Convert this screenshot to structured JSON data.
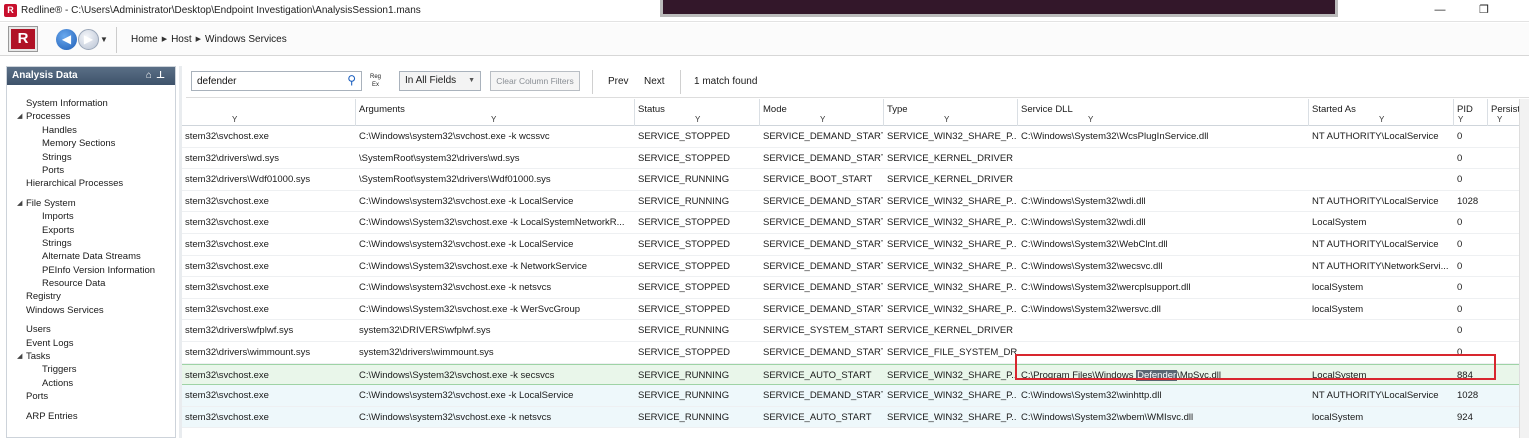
{
  "window": {
    "title": "Redline® - C:\\Users\\Administrator\\Desktop\\Endpoint Investigation\\AnalysisSession1.mans",
    "logo_letter": "R",
    "minimize": "—",
    "restore": "❐"
  },
  "nav": {
    "breadcrumb": [
      "Home",
      "Host",
      "Windows Services"
    ],
    "back_glyph": "◀",
    "forward_glyph": "▶",
    "dropdown_glyph": "▼"
  },
  "sidebar": {
    "title": "Analysis Data",
    "items": [
      {
        "label": "System Information",
        "level": 0
      },
      {
        "label": "Processes",
        "level": 0,
        "expanded": true
      },
      {
        "label": "Handles",
        "level": 1
      },
      {
        "label": "Memory Sections",
        "level": 1
      },
      {
        "label": "Strings",
        "level": 1
      },
      {
        "label": "Ports",
        "level": 1
      },
      {
        "label": "Hierarchical Processes",
        "level": 0
      },
      {
        "label": "File System",
        "level": 0,
        "expanded": true,
        "gap_before": true
      },
      {
        "label": "Imports",
        "level": 1
      },
      {
        "label": "Exports",
        "level": 1
      },
      {
        "label": "Strings",
        "level": 1
      },
      {
        "label": "Alternate Data Streams",
        "level": 1
      },
      {
        "label": "PEInfo Version Information",
        "level": 1
      },
      {
        "label": "Resource Data",
        "level": 1
      },
      {
        "label": "Registry",
        "level": 0
      },
      {
        "label": "Windows Services",
        "level": 0
      },
      {
        "label": "Users",
        "level": 0,
        "gap_before": true
      },
      {
        "label": "Event Logs",
        "level": 0
      },
      {
        "label": "Tasks",
        "level": 0,
        "expanded": true
      },
      {
        "label": "Triggers",
        "level": 1
      },
      {
        "label": "Actions",
        "level": 1
      },
      {
        "label": "Ports",
        "level": 0
      },
      {
        "label": "ARP Entries",
        "level": 0,
        "gap_before": true
      }
    ]
  },
  "toolbar": {
    "search_value": "defender",
    "regex_label": [
      "Reg",
      "Ex"
    ],
    "field_scope": "In All Fields",
    "clear_filters": "Clear Column Filters",
    "prev": "Prev",
    "next": "Next",
    "match_status": "1 match found"
  },
  "table": {
    "columns": [
      "",
      "Arguments",
      "Status",
      "Mode",
      "Type",
      "Service DLL",
      "Started As",
      "PID",
      "Persist"
    ],
    "rows": [
      [
        "stem32\\svchost.exe",
        "C:\\Windows\\system32\\svchost.exe -k wcssvc",
        "SERVICE_STOPPED",
        "SERVICE_DEMAND_START",
        "SERVICE_WIN32_SHARE_P...",
        "C:\\Windows\\System32\\WcsPlugInService.dll",
        "NT AUTHORITY\\LocalService",
        "0"
      ],
      [
        "stem32\\drivers\\wd.sys",
        "\\SystemRoot\\system32\\drivers\\wd.sys",
        "SERVICE_STOPPED",
        "SERVICE_DEMAND_START",
        "SERVICE_KERNEL_DRIVER",
        "",
        "",
        "0"
      ],
      [
        "stem32\\drivers\\Wdf01000.sys",
        "\\SystemRoot\\system32\\drivers\\Wdf01000.sys",
        "SERVICE_RUNNING",
        "SERVICE_BOOT_START",
        "SERVICE_KERNEL_DRIVER",
        "",
        "",
        "0"
      ],
      [
        "stem32\\svchost.exe",
        "C:\\Windows\\system32\\svchost.exe -k LocalService",
        "SERVICE_RUNNING",
        "SERVICE_DEMAND_START",
        "SERVICE_WIN32_SHARE_P...",
        "C:\\Windows\\System32\\wdi.dll",
        "NT AUTHORITY\\LocalService",
        "1028"
      ],
      [
        "stem32\\svchost.exe",
        "C:\\Windows\\System32\\svchost.exe -k LocalSystemNetworkR...",
        "SERVICE_STOPPED",
        "SERVICE_DEMAND_START",
        "SERVICE_WIN32_SHARE_P...",
        "C:\\Windows\\System32\\wdi.dll",
        "LocalSystem",
        "0"
      ],
      [
        "stem32\\svchost.exe",
        "C:\\Windows\\system32\\svchost.exe -k LocalService",
        "SERVICE_STOPPED",
        "SERVICE_DEMAND_START",
        "SERVICE_WIN32_SHARE_P...",
        "C:\\Windows\\System32\\WebClnt.dll",
        "NT AUTHORITY\\LocalService",
        "0"
      ],
      [
        "stem32\\svchost.exe",
        "C:\\Windows\\System32\\svchost.exe -k NetworkService",
        "SERVICE_STOPPED",
        "SERVICE_DEMAND_START",
        "SERVICE_WIN32_SHARE_P...",
        "C:\\Windows\\System32\\wecsvc.dll",
        "NT AUTHORITY\\NetworkServi...",
        "0"
      ],
      [
        "stem32\\svchost.exe",
        "C:\\Windows\\system32\\svchost.exe -k netsvcs",
        "SERVICE_STOPPED",
        "SERVICE_DEMAND_START",
        "SERVICE_WIN32_SHARE_P...",
        "C:\\Windows\\System32\\wercplsupport.dll",
        "localSystem",
        "0"
      ],
      [
        "stem32\\svchost.exe",
        "C:\\Windows\\System32\\svchost.exe -k WerSvcGroup",
        "SERVICE_STOPPED",
        "SERVICE_DEMAND_START",
        "SERVICE_WIN32_SHARE_P...",
        "C:\\Windows\\System32\\wersvc.dll",
        "localSystem",
        "0"
      ],
      [
        "stem32\\drivers\\wfplwf.sys",
        "system32\\DRIVERS\\wfplwf.sys",
        "SERVICE_RUNNING",
        "SERVICE_SYSTEM_START",
        "SERVICE_KERNEL_DRIVER",
        "",
        "",
        "0"
      ],
      [
        "stem32\\drivers\\wimmount.sys",
        "system32\\drivers\\wimmount.sys",
        "SERVICE_STOPPED",
        "SERVICE_DEMAND_START",
        "SERVICE_FILE_SYSTEM_DRI...",
        "",
        "",
        "0"
      ],
      [
        "stem32\\svchost.exe",
        "C:\\Windows\\System32\\svchost.exe -k secsvcs",
        "SERVICE_RUNNING",
        "SERVICE_AUTO_START",
        "SERVICE_WIN32_SHARE_P...",
        "C:\\Program Files\\Windows Defender\\MpSvc.dll",
        "LocalSystem",
        "884"
      ],
      [
        "stem32\\svchost.exe",
        "C:\\Windows\\system32\\svchost.exe -k LocalService",
        "SERVICE_RUNNING",
        "SERVICE_DEMAND_START",
        "SERVICE_WIN32_SHARE_P...",
        "C:\\Windows\\System32\\winhttp.dll",
        "NT AUTHORITY\\LocalService",
        "1028"
      ],
      [
        "stem32\\svchost.exe",
        "C:\\Windows\\system32\\svchost.exe -k netsvcs",
        "SERVICE_RUNNING",
        "SERVICE_AUTO_START",
        "SERVICE_WIN32_SHARE_P...",
        "C:\\Windows\\System32\\wbem\\WMIsvc.dll",
        "localSystem",
        "924"
      ]
    ],
    "match_row": 11,
    "match_text": "Defender",
    "selected_rows": [
      11
    ],
    "alt_rows": [
      12,
      13
    ],
    "highlight_colors": {
      "match_border": "#d8262e",
      "selected_row": "#e9f6ea",
      "alt_row": "#eef8fb"
    }
  }
}
